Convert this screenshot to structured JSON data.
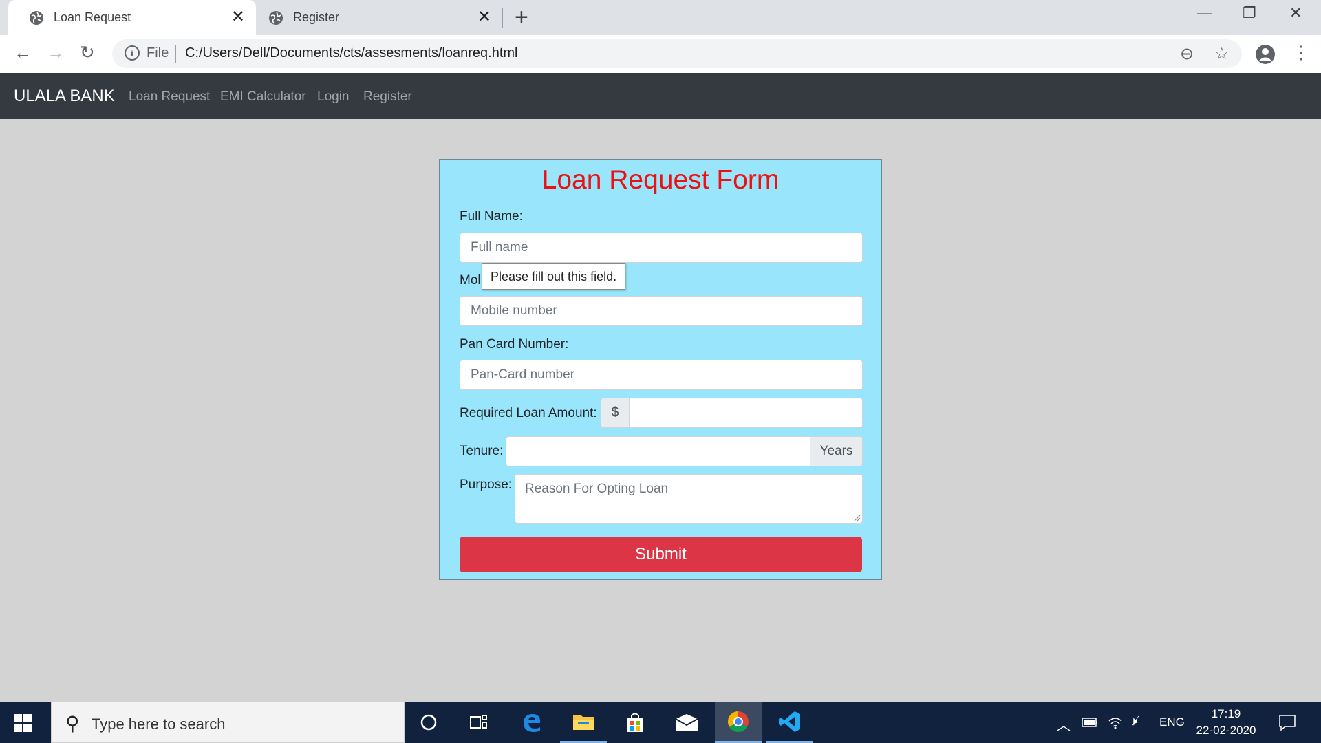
{
  "browser": {
    "tabs": [
      {
        "title": "Loan Request",
        "active": true
      },
      {
        "title": "Register",
        "active": false
      }
    ],
    "new_tab_icon": "plus-icon",
    "address": {
      "scheme_label": "File",
      "url": "C:/Users/Dell/Documents/cts/assesments/loanreq.html"
    },
    "window_controls": [
      "minimize-icon",
      "restore-icon",
      "close-icon"
    ]
  },
  "navbar": {
    "brand": "ULALA BANK",
    "links": [
      "Loan Request",
      "EMI Calculator",
      "Login",
      "Register"
    ]
  },
  "form": {
    "title": "Loan Request Form",
    "full_name": {
      "label": "Full Name:",
      "placeholder": "Full name",
      "value": ""
    },
    "mobile": {
      "label": "Mobile Number:",
      "label_visible": "Mol",
      "placeholder": "Mobile number",
      "value": ""
    },
    "pan": {
      "label": "Pan Card Number:",
      "placeholder": "Pan-Card number",
      "value": ""
    },
    "amount": {
      "label": "Required Loan Amount:",
      "prefix": "$",
      "value": ""
    },
    "tenure": {
      "label": "Tenure:",
      "suffix": "Years",
      "value": ""
    },
    "purpose": {
      "label": "Purpose:",
      "placeholder": "Reason For Opting Loan",
      "value": ""
    },
    "submit_label": "Submit",
    "validation_tooltip": "Please fill out this field."
  },
  "taskbar": {
    "search_placeholder": "Type here to search",
    "apps": [
      "cortana-icon",
      "task-view-icon",
      "edge-icon",
      "file-explorer-icon",
      "store-icon",
      "mail-icon",
      "chrome-icon",
      "vscode-icon"
    ],
    "tray": {
      "language": "ENG"
    },
    "clock": {
      "time": "17:19",
      "date": "22-02-2020"
    }
  },
  "colors": {
    "navbar_bg": "#343a40",
    "card_bg": "#99e6fc",
    "title_red": "#ee1111",
    "submit_bg": "#dc3545",
    "page_bg": "#d3d3d3"
  }
}
